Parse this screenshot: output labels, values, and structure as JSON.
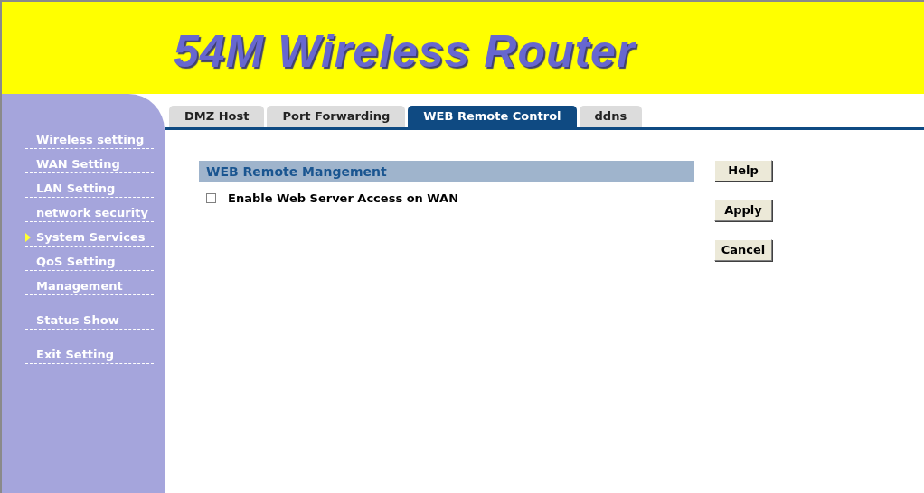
{
  "header": {
    "title": "54M Wireless Router"
  },
  "sidebar": {
    "sections": [
      [
        {
          "label": "Wireless setting",
          "selected": false
        },
        {
          "label": "WAN Setting",
          "selected": false
        },
        {
          "label": "LAN Setting",
          "selected": false
        },
        {
          "label": "network security",
          "selected": false
        },
        {
          "label": "System Services",
          "selected": true
        },
        {
          "label": "QoS Setting",
          "selected": false
        },
        {
          "label": "Management",
          "selected": false
        }
      ],
      [
        {
          "label": "Status Show",
          "selected": false
        }
      ],
      [
        {
          "label": "Exit Setting",
          "selected": false
        }
      ]
    ]
  },
  "tabs": [
    {
      "label": "DMZ Host",
      "selected": false
    },
    {
      "label": "Port Forwarding",
      "selected": false
    },
    {
      "label": "WEB Remote Control",
      "selected": true
    },
    {
      "label": "ddns",
      "selected": false
    }
  ],
  "section": {
    "title": "WEB Remote Mangement",
    "options": [
      {
        "label": "Enable Web Server Access on WAN",
        "checked": false
      }
    ]
  },
  "buttons": [
    "Help",
    "Apply",
    "Cancel"
  ]
}
